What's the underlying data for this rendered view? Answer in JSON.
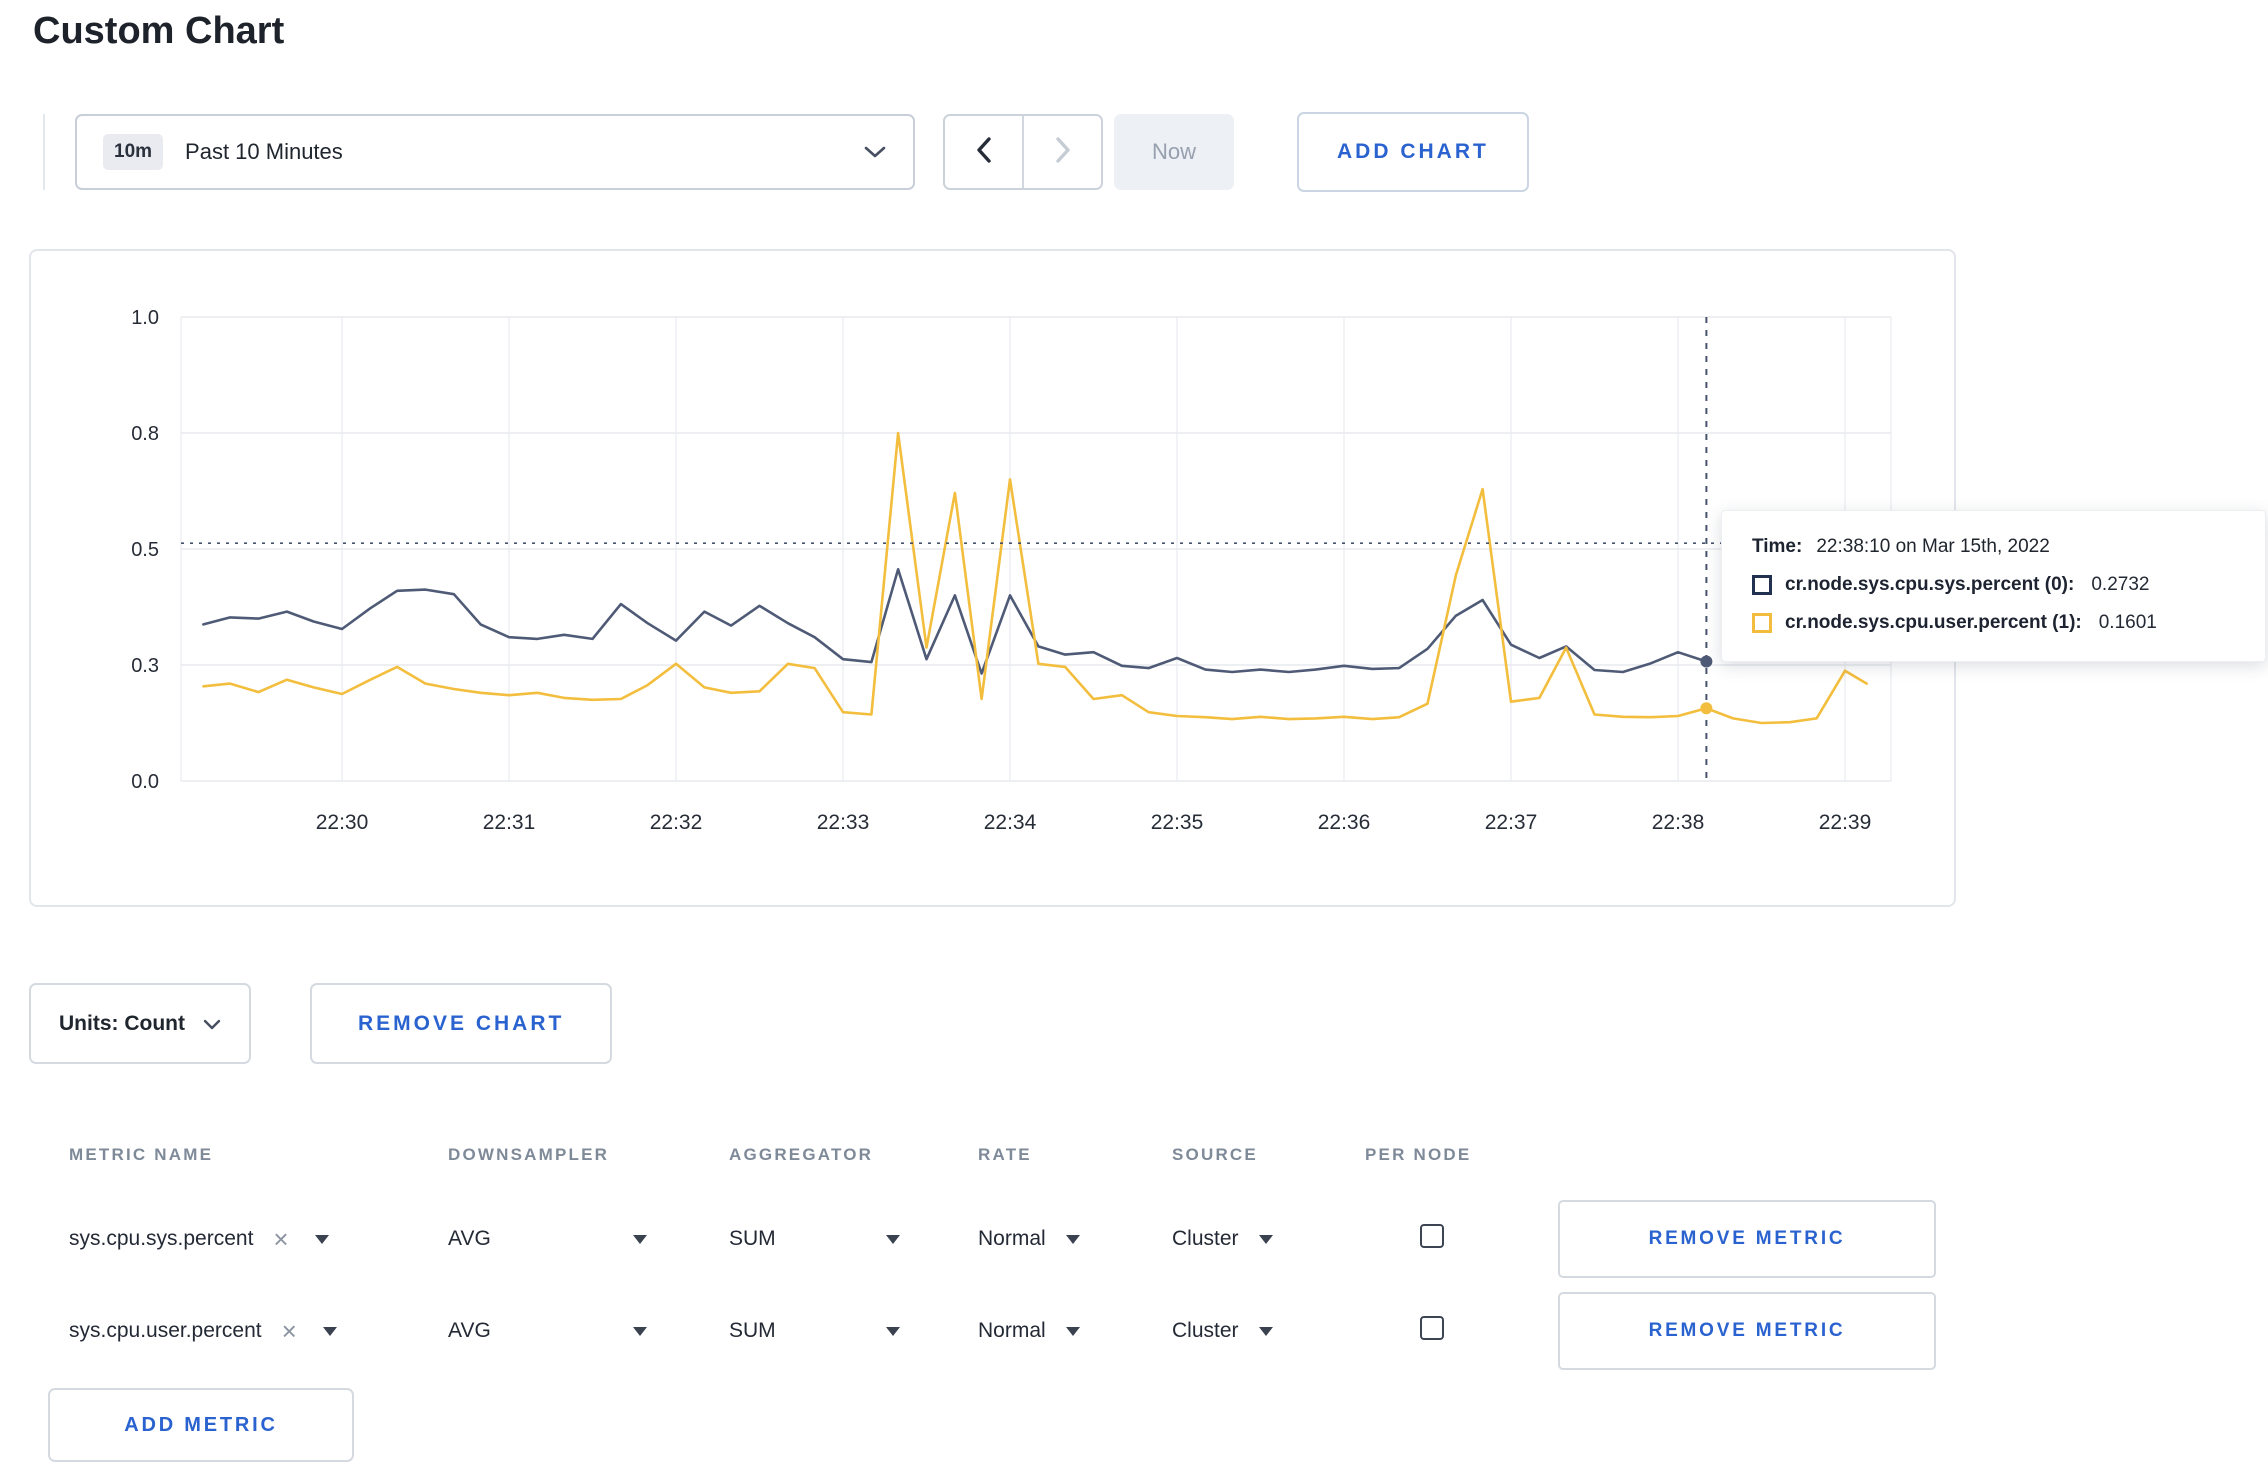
{
  "page": {
    "title": "Custom Chart"
  },
  "colors": {
    "accent_blue": "#2a63cf",
    "series_sys": "#4f5b76",
    "series_user": "#f3be3d"
  },
  "toolbar": {
    "time_badge": "10m",
    "time_label": "Past 10 Minutes",
    "now_label": "Now",
    "add_chart_label": "ADD CHART"
  },
  "chart_data": {
    "type": "line",
    "title": "",
    "x_ticks": [
      "22:30",
      "22:31",
      "22:32",
      "22:33",
      "22:34",
      "22:35",
      "22:36",
      "22:37",
      "22:38",
      "22:39"
    ],
    "y_ticks": [
      0.0,
      0.3,
      0.5,
      0.8,
      1.0
    ],
    "y_tick_labels": [
      "0.0",
      "0.3",
      "0.5",
      "0.8",
      "1.0"
    ],
    "y_scale_note": "ticks evenly spaced (piecewise scale), grid on, no legend box (hover tooltip)",
    "series": [
      {
        "name": "cr.node.sys.cpu.sys.percent",
        "color": "#4f5b76",
        "points": [
          [
            -0.83,
            0.37
          ],
          [
            -0.67,
            0.382
          ],
          [
            -0.5,
            0.38
          ],
          [
            -0.33,
            0.392
          ],
          [
            -0.17,
            0.375
          ],
          [
            0,
            0.362
          ],
          [
            0.17,
            0.398
          ],
          [
            0.33,
            0.428
          ],
          [
            0.5,
            0.43
          ],
          [
            0.67,
            0.422
          ],
          [
            0.83,
            0.37
          ],
          [
            1,
            0.348
          ],
          [
            1.17,
            0.345
          ],
          [
            1.33,
            0.352
          ],
          [
            1.5,
            0.345
          ],
          [
            1.67,
            0.405
          ],
          [
            1.83,
            0.372
          ],
          [
            2,
            0.342
          ],
          [
            2.17,
            0.392
          ],
          [
            2.33,
            0.368
          ],
          [
            2.5,
            0.402
          ],
          [
            2.67,
            0.372
          ],
          [
            2.83,
            0.348
          ],
          [
            3,
            0.31
          ],
          [
            3.17,
            0.305
          ],
          [
            3.33,
            0.465
          ],
          [
            3.5,
            0.31
          ],
          [
            3.67,
            0.42
          ],
          [
            3.83,
            0.278
          ],
          [
            4,
            0.42
          ],
          [
            4.17,
            0.332
          ],
          [
            4.33,
            0.318
          ],
          [
            4.5,
            0.322
          ],
          [
            4.67,
            0.298
          ],
          [
            4.83,
            0.292
          ],
          [
            5,
            0.312
          ],
          [
            5.17,
            0.288
          ],
          [
            5.33,
            0.282
          ],
          [
            5.5,
            0.288
          ],
          [
            5.67,
            0.282
          ],
          [
            5.83,
            0.288
          ],
          [
            6,
            0.298
          ],
          [
            6.17,
            0.29
          ],
          [
            6.33,
            0.292
          ],
          [
            6.5,
            0.328
          ],
          [
            6.67,
            0.385
          ],
          [
            6.83,
            0.412
          ],
          [
            7,
            0.335
          ],
          [
            7.17,
            0.312
          ],
          [
            7.33,
            0.332
          ],
          [
            7.5,
            0.287
          ],
          [
            7.67,
            0.282
          ],
          [
            7.83,
            0.302
          ],
          [
            8,
            0.322
          ],
          [
            8.17,
            0.306
          ]
        ]
      },
      {
        "name": "cr.node.sys.cpu.user.percent",
        "color": "#f3be3d",
        "points": [
          [
            -0.83,
            0.245
          ],
          [
            -0.67,
            0.252
          ],
          [
            -0.5,
            0.23
          ],
          [
            -0.33,
            0.262
          ],
          [
            -0.17,
            0.242
          ],
          [
            0,
            0.225
          ],
          [
            0.17,
            0.262
          ],
          [
            0.33,
            0.295
          ],
          [
            0.5,
            0.252
          ],
          [
            0.67,
            0.238
          ],
          [
            0.83,
            0.228
          ],
          [
            1,
            0.222
          ],
          [
            1.17,
            0.228
          ],
          [
            1.33,
            0.215
          ],
          [
            1.5,
            0.21
          ],
          [
            1.67,
            0.212
          ],
          [
            1.83,
            0.248
          ],
          [
            2,
            0.302
          ],
          [
            2.17,
            0.242
          ],
          [
            2.33,
            0.228
          ],
          [
            2.5,
            0.232
          ],
          [
            2.67,
            0.302
          ],
          [
            2.83,
            0.292
          ],
          [
            3,
            0.178
          ],
          [
            3.17,
            0.172
          ],
          [
            3.33,
            0.8
          ],
          [
            3.5,
            0.33
          ],
          [
            3.67,
            0.645
          ],
          [
            3.83,
            0.212
          ],
          [
            4,
            0.68
          ],
          [
            4.17,
            0.302
          ],
          [
            4.33,
            0.295
          ],
          [
            4.5,
            0.212
          ],
          [
            4.67,
            0.222
          ],
          [
            4.83,
            0.178
          ],
          [
            5,
            0.168
          ],
          [
            5.17,
            0.165
          ],
          [
            5.33,
            0.16
          ],
          [
            5.5,
            0.166
          ],
          [
            5.67,
            0.16
          ],
          [
            5.83,
            0.162
          ],
          [
            6,
            0.166
          ],
          [
            6.17,
            0.16
          ],
          [
            6.33,
            0.165
          ],
          [
            6.5,
            0.2
          ],
          [
            6.67,
            0.455
          ],
          [
            6.83,
            0.655
          ],
          [
            7,
            0.205
          ],
          [
            7.17,
            0.215
          ],
          [
            7.33,
            0.33
          ],
          [
            7.5,
            0.172
          ],
          [
            7.67,
            0.166
          ],
          [
            7.83,
            0.165
          ],
          [
            8,
            0.168
          ],
          [
            8.17,
            0.188
          ],
          [
            8.33,
            0.162
          ],
          [
            8.5,
            0.15
          ],
          [
            8.67,
            0.152
          ],
          [
            8.83,
            0.162
          ],
          [
            9,
            0.285
          ],
          [
            9.13,
            0.252
          ]
        ]
      }
    ],
    "crosshair": {
      "x_minutes": 8.17,
      "x_time": "22:38:10",
      "y_value": 0.515,
      "dots": [
        {
          "series": 0,
          "value": 0.306
        },
        {
          "series": 1,
          "value": 0.188
        }
      ]
    }
  },
  "tooltip": {
    "time_label": "Time:",
    "time_value": "22:38:10 on Mar 15th, 2022",
    "rows": [
      {
        "label": "cr.node.sys.cpu.sys.percent (0):",
        "value": "0.2732",
        "swatch_color": "#22314f"
      },
      {
        "label": "cr.node.sys.cpu.user.percent (1):",
        "value": "0.1601",
        "swatch_color": "#f2bd3e"
      }
    ]
  },
  "chart_footer": {
    "units_label": "Units: Count",
    "remove_chart_label": "REMOVE CHART"
  },
  "metrics_table": {
    "headers": [
      "METRIC NAME",
      "DOWNSAMPLER",
      "AGGREGATOR",
      "RATE",
      "SOURCE",
      "PER NODE"
    ],
    "rows": [
      {
        "metric": "sys.cpu.sys.percent",
        "downsampler": "AVG",
        "aggregator": "SUM",
        "rate": "Normal",
        "source": "Cluster",
        "per_node_checked": false,
        "remove_label": "REMOVE METRIC"
      },
      {
        "metric": "sys.cpu.user.percent",
        "downsampler": "AVG",
        "aggregator": "SUM",
        "rate": "Normal",
        "source": "Cluster",
        "per_node_checked": false,
        "remove_label": "REMOVE METRIC"
      }
    ],
    "add_metric_label": "ADD METRIC"
  }
}
